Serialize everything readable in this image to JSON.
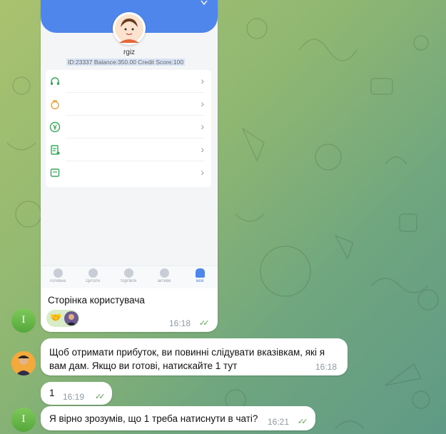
{
  "screenshot": {
    "user_name": "rgiz",
    "user_info": "ID:23337  Balance:350.00  Credit Score:100",
    "menu_items": [
      {
        "icon": "headset-icon"
      },
      {
        "icon": "lock-icon"
      },
      {
        "icon": "yen-coin-icon"
      },
      {
        "icon": "document-icon"
      },
      {
        "icon": "wallet-icon"
      }
    ],
    "tabs": [
      {
        "label": "головна"
      },
      {
        "label": "Цитати"
      },
      {
        "label": "торгівля"
      },
      {
        "label": "активи"
      },
      {
        "label": "моя"
      }
    ]
  },
  "messages": {
    "m1": {
      "text": "Сторінка користувача",
      "time": "16:18",
      "sender_initial": "I"
    },
    "m2": {
      "text": "Щоб отримати прибуток, ви повинні слідувати вказівкам, які я вам дам. Якщо ви готові, натискайте 1 тут",
      "time": "16:18"
    },
    "m3": {
      "text": "1",
      "time": "16:19",
      "sender_initial": "I"
    },
    "m4": {
      "text": "Я вірно зрозумів, що 1 треба натиснути в чаті?",
      "time": "16:21",
      "sender_initial": "I"
    }
  },
  "colors": {
    "accent": "#4f86ec",
    "check": "#5aa34f"
  }
}
